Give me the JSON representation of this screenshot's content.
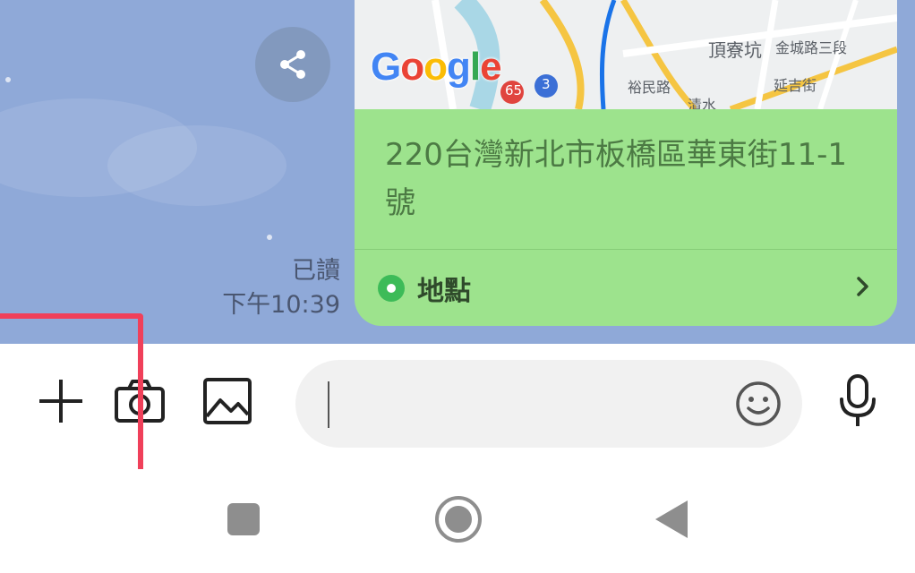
{
  "chat": {
    "read_status": "已讀",
    "timestamp": "下午10:39",
    "share_icon": "share-icon"
  },
  "location_message": {
    "map": {
      "provider_logo": "Google",
      "labels": [
        "頂寮坑",
        "金城路三段",
        "延吉街",
        "裕民路",
        "清水",
        "65",
        "3"
      ]
    },
    "address": "220台灣新北市板橋區華東街11-1號",
    "place_label": "地點",
    "bubble_color": "#9de38d"
  },
  "input_bar": {
    "message_value": "",
    "buttons": [
      "plus-icon",
      "camera-icon",
      "image-icon",
      "emoji-icon",
      "microphone-icon"
    ]
  },
  "nav_bar": {
    "buttons": [
      "recent-apps-icon",
      "home-icon",
      "back-icon"
    ]
  },
  "colors": {
    "chat_background": "#8fa9d8",
    "highlight": "#f0405a"
  }
}
